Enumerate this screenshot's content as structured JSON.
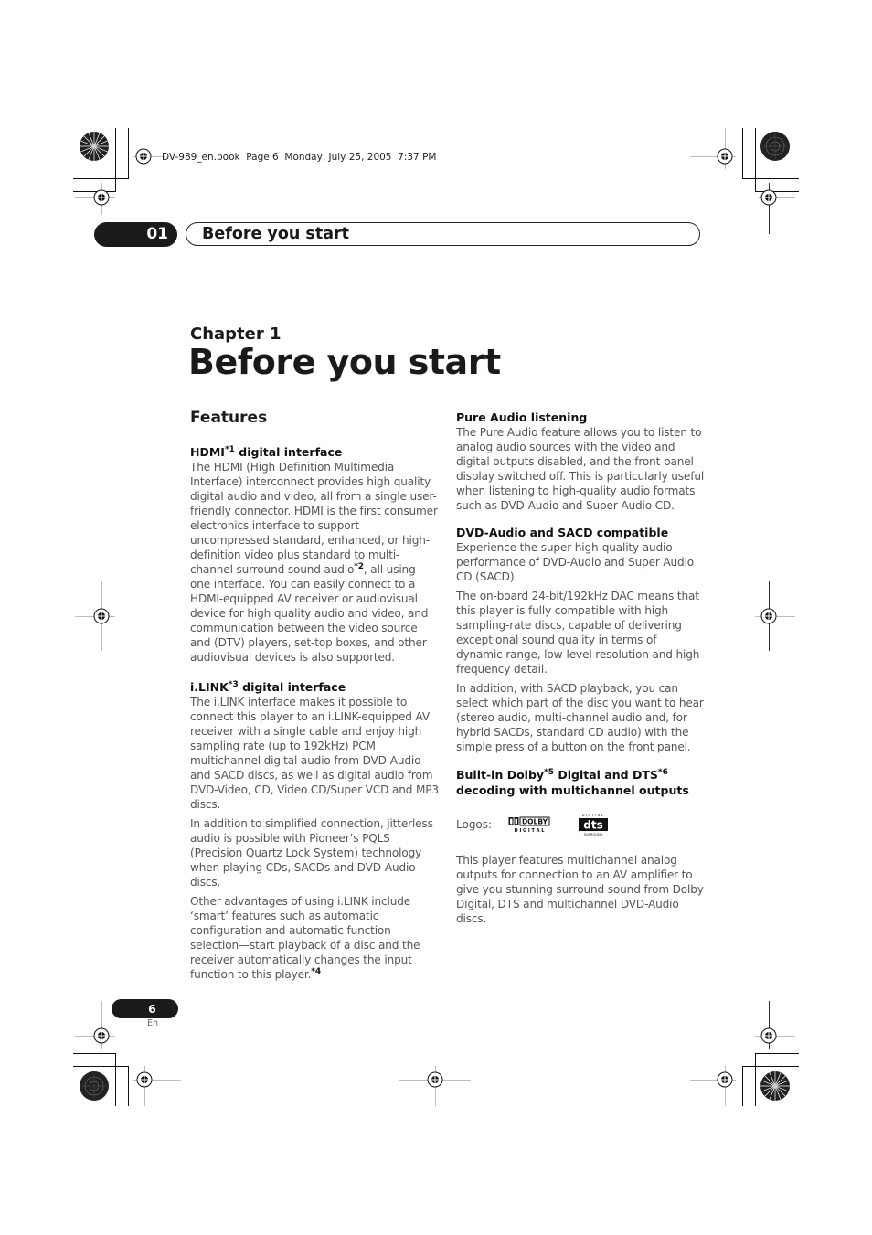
{
  "slug_line": "DV-989_en.book  Page 6  Monday, July 25, 2005  7:37 PM",
  "header": {
    "chapter_number": "01",
    "chapter_title": "Before you start"
  },
  "chapter_label": "Chapter 1",
  "page_title": "Before you start",
  "section_title": "Features",
  "left_column": {
    "hdmi": {
      "heading_pre": "HDMI",
      "heading_sup": "*1",
      "heading_post": " digital interface",
      "para1_a": "The HDMI (High Definition Multimedia Interface) interconnect provides high quality digital audio and video, all from a single user-friendly connector. HDMI is the first consumer electronics interface to support uncompressed standard, enhanced, or high-definition video plus standard to multi-channel surround sound audio",
      "para1_sup": "*2",
      "para1_b": ", all using one interface. You can easily connect to a HDMI-equipped AV receiver or audiovisual device for high quality audio and video, and communication between the video source and (DTV) players, set-top boxes, and other audiovisual devices is also supported."
    },
    "ilink": {
      "heading_pre": "i.LINK",
      "heading_sup": "*3",
      "heading_post": " digital interface",
      "para1": "The i.LINK interface makes it possible to connect this player to an i.LINK-equipped AV receiver with a single cable and enjoy high sampling rate (up to 192kHz) PCM multichannel digital audio from DVD-Audio and SACD discs, as well as digital audio from DVD-Video, CD, Video CD/Super VCD and MP3 discs.",
      "para2": "In addition to simplified connection, jitterless audio is possible with Pioneer’s PQLS (Precision Quartz Lock System) technology when playing CDs, SACDs and DVD-Audio discs.",
      "para3_a": "Other advantages of using i.LINK include ‘smart’ features such as automatic configuration and automatic function selection—start playback of a disc and the receiver automatically changes the input function to this player.",
      "para3_sup": "*4"
    }
  },
  "right_column": {
    "pure_audio": {
      "heading": "Pure Audio listening",
      "para1": "The Pure Audio feature allows you to listen to analog audio sources with the video and digital outputs disabled, and the front panel display switched off. This is particularly useful when listening to high-quality audio formats such as DVD-Audio and Super Audio CD."
    },
    "dvd_audio": {
      "heading": "DVD-Audio and SACD compatible",
      "para1": "Experience the super high-quality audio performance of DVD-Audio and Super Audio CD (SACD).",
      "para2": "The on-board 24-bit/192kHz DAC means that this player is fully compatible with high sampling-rate discs, capable of delivering exceptional sound quality in terms of dynamic range, low-level resolution and high-frequency detail.",
      "para3": "In addition, with SACD playback, you can select which part of the disc you want to hear (stereo audio, multi-channel audio and, for hybrid SACDs, standard CD audio) with the simple press of a button on the front panel."
    },
    "dolby_dts": {
      "heading_a": "Built-in Dolby",
      "heading_sup1": "*5",
      "heading_b": " Digital and DTS",
      "heading_sup2": "*6",
      "heading_c": "decoding with multichannel outputs",
      "logos_label": "Logos:",
      "dolby_logo_text": "DOLBY",
      "dolby_logo_sub": "D I G I T A L",
      "dts_logo_top": "DIGITAL",
      "dts_logo_text": "dts",
      "dts_logo_bottom": "SURROUND",
      "para1": "This player features multichannel analog outputs for connection to an AV amplifier to give you stunning surround sound from Dolby Digital, DTS and multichannel DVD-Audio discs."
    }
  },
  "footer": {
    "page_number": "6",
    "language": "En"
  }
}
